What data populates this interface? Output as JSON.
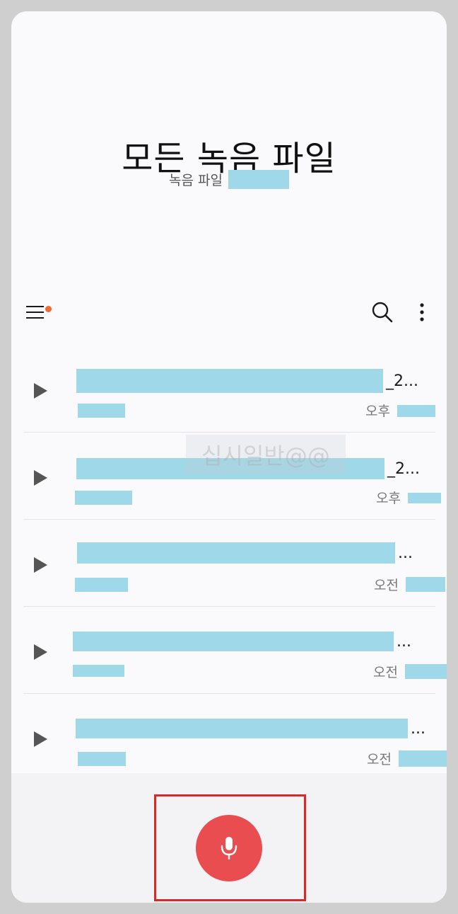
{
  "header": {
    "title": "모든 녹음 파일",
    "subtitle": "녹음 파일"
  },
  "toolbar": {
    "menu_icon": "hamburger-menu-icon",
    "search_icon": "search-icon",
    "more_icon": "more-vert-icon",
    "notification_dot_color": "#ef6a35"
  },
  "recordings": [
    {
      "title_suffix": "_2...",
      "time_period": "오후"
    },
    {
      "title_suffix": "_2...",
      "time_period": "오후"
    },
    {
      "title_suffix": "...",
      "time_period": "오전"
    },
    {
      "title_suffix": "...",
      "time_period": "오전"
    },
    {
      "title_suffix": "...",
      "time_period": "오전"
    }
  ],
  "watermark": "십시일반@@",
  "record_button": {
    "icon": "microphone-icon",
    "color": "#ea4d4f"
  },
  "colors": {
    "redaction": "#9fd8e8",
    "highlight_border": "#d42a2a"
  }
}
